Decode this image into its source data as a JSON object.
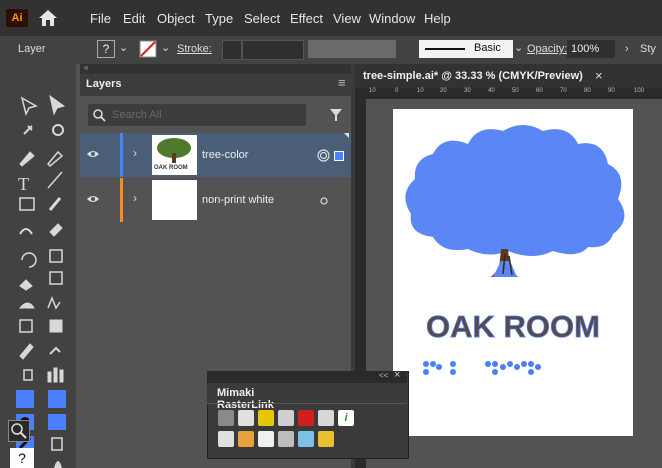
{
  "app": {
    "logo": "Ai"
  },
  "menubar": {
    "items": [
      "File",
      "Edit",
      "Object",
      "Type",
      "Select",
      "Effect",
      "View",
      "Window",
      "Help"
    ]
  },
  "control_bar": {
    "selection_label": "Layer",
    "question_mark": "?",
    "stroke_label": "Stroke:",
    "brush_style": "Basic",
    "opacity_label": "Opacity:",
    "opacity_value": "100%",
    "style_label": "Sty"
  },
  "layers_panel": {
    "tab_label": "Layers",
    "search_placeholder": "Search All",
    "layers": [
      {
        "name": "tree-color",
        "thumb_text": "OAK ROOM",
        "color": "#4a7fff",
        "selected": true
      },
      {
        "name": "non-print white",
        "thumb_text": "",
        "color": "#ff8a20",
        "selected": false
      }
    ]
  },
  "document": {
    "tab_title": "tree-simple.ai* @ 33.33 % (CMYK/Preview)",
    "close_glyph": "×",
    "ruler_ticks": [
      "10",
      "0",
      "10",
      "20",
      "30",
      "40",
      "50",
      "60",
      "70",
      "80",
      "90",
      "100"
    ],
    "art_title": "OAK ROOM"
  },
  "mimaki_panel": {
    "title": "Mimaki RasterLink",
    "collapse": "<<",
    "close": "×"
  },
  "colors": {
    "accent": "#4a7fff",
    "selection_row": "#4a5e78",
    "orange": "#ff8a20",
    "tree_blue": "#5b86f5"
  }
}
